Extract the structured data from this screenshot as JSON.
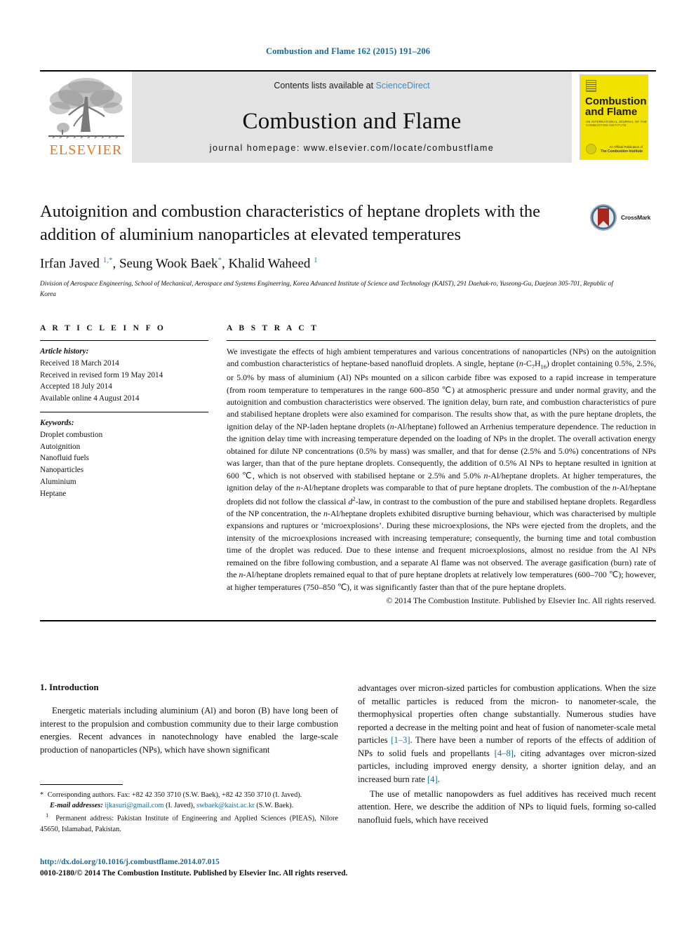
{
  "running_head": "Combustion and Flame 162 (2015) 191–206",
  "masthead": {
    "contents_prefix": "Contents lists available at ",
    "sciencedirect": "ScienceDirect",
    "journal_title": "Combustion and Flame",
    "homepage": "journal homepage: www.elsevier.com/locate/combustflame",
    "publisher_name": "ELSEVIER",
    "cover": {
      "line1": "Combustion",
      "line2": "and Flame",
      "subtitle": "AN INTERNATIONAL JOURNAL OF THE COMBUSTION INSTITUTE",
      "footer_small": "An Official Publication of",
      "footer_bold": "The Combustion Institute"
    }
  },
  "article": {
    "title": "Autoignition and combustion characteristics of heptane droplets with the addition of aluminium nanoparticles at elevated temperatures",
    "crossmark_label": "CrossMark",
    "authors_html": "Irfan Javed <sup class=\"lnk\">1,*</sup>, Seung Wook Baek<sup class=\"lnk\">*</sup>, Khalid Waheed <sup class=\"lnk\">1</sup>",
    "affiliation": "Division of Aerospace Engineering, School of Mechanical, Aerospace and Systems Engineering, Korea Advanced Institute of Science and Technology (KAIST), 291 Daehak-ro, Yuseong-Gu, Daejeon 305-701, Republic of Korea"
  },
  "article_info": {
    "heading": "A R T I C L E    I N F O",
    "history_label": "Article history:",
    "history": [
      "Received 18 March 2014",
      "Received in revised form 19 May 2014",
      "Accepted 18 July 2014",
      "Available online 4 August 2014"
    ],
    "keywords_label": "Keywords:",
    "keywords": [
      "Droplet combustion",
      "Autoignition",
      "Nanofluid fuels",
      "Nanoparticles",
      "Aluminium",
      "Heptane"
    ]
  },
  "abstract": {
    "heading": "A B S T R A C T",
    "body_html": "We investigate the effects of high ambient temperatures and various concentrations of nanoparticles (NPs) on the autoignition and combustion characteristics of heptane-based nanofluid droplets. A single, heptane (<i>n</i>-C<sub>7</sub>H<sub>16</sub>) droplet containing 0.5%, 2.5%, or 5.0% by mass of aluminium (Al) NPs mounted on a silicon carbide fibre was exposed to a rapid increase in temperature (from room temperature to temperatures in the range 600–850 &#8451;) at atmospheric pressure and under normal gravity, and the autoignition and combustion characteristics were observed. The ignition delay, burn rate, and combustion characteristics of pure and stabilised heptane droplets were also examined for comparison. The results show that, as with the pure heptane droplets, the ignition delay of the NP-laden heptane droplets (<i>n</i>-Al/heptane) followed an Arrhenius temperature dependence. The reduction in the ignition delay time with increasing temperature depended on the loading of NPs in the droplet. The overall activation energy obtained for dilute NP concentrations (0.5% by mass) was smaller, and that for dense (2.5% and 5.0%) concentrations of NPs was larger, than that of the pure heptane droplets. Consequently, the addition of 0.5% Al NPs to heptane resulted in ignition at 600 &#8451;, which is not observed with stabilised heptane or 2.5% and 5.0% <i>n</i>-Al/heptane droplets. At higher temperatures, the ignition delay of the <i>n</i>-Al/heptane droplets was comparable to that of pure heptane droplets. The combustion of the <i>n</i>-Al/heptane droplets did not follow the classical <i>d</i><sup class=\"s\">2</sup>-law, in contrast to the combustion of the pure and stabilised heptane droplets. Regardless of the NP concentration, the <i>n</i>-Al/heptane droplets exhibited disruptive burning behaviour, which was characterised by multiple expansions and ruptures or ‘microexplosions’. During these microexplosions, the NPs were ejected from the droplets, and the intensity of the microexplosions increased with increasing temperature; consequently, the burning time and total combustion time of the droplet was reduced. Due to these intense and frequent microexplosions, almost no residue from the Al NPs remained on the fibre following combustion, and a separate Al flame was not observed. The average gasification (burn) rate of the <i>n</i>-Al/heptane droplets remained equal to that of pure heptane droplets at relatively low temperatures (600–700 &#8451;); however, at higher temperatures (750–850 &#8451;), it was significantly faster than that of the pure heptane droplets.",
    "copyright": "© 2014 The Combustion Institute. Published by Elsevier Inc. All rights reserved."
  },
  "introduction": {
    "heading": "1. Introduction",
    "para1": "Energetic materials including aluminium (Al) and boron (B) have long been of interest to the propulsion and combustion community due to their large combustion energies. Recent advances in nanotechnology have enabled the large-scale production of nanoparticles (NPs), which have shown significant",
    "para2_html": "advantages over micron-sized particles for combustion applications. When the size of metallic particles is reduced from the micron- to nanometer-scale, the thermophysical properties often change substantially. Numerous studies have reported a decrease in the melting point and heat of fusion of nanometer-scale metal particles <span class=\"ref\">[1–3]</span>. There have been a number of reports of the effects of addition of NPs to solid fuels and propellants <span class=\"ref\">[4–8]</span>, citing advantages over micron-sized particles, including improved energy density, a shorter ignition delay, and an increased burn rate <span class=\"ref\">[4]</span>.",
    "para3": "The use of metallic nanopowders as fuel additives has received much recent attention. Here, we describe the addition of NPs to liquid fuels, forming so-called nanofluid fuels, which have received"
  },
  "footnotes": {
    "corresponding_html": "<span class=\"sym\">*</span>&nbsp; Corresponding authors. Fax: +82 42 350 3710 (S.W. Baek), +82 42 350 3710 (I. Javed).",
    "emails_html": "<i>E-mail addresses:</i> <span class=\"mail\">ijkasuri@gmail.com</span> (I. Javed), <span class=\"mail\">swbaek@kaist.ac.kr</span> (S.W. Baek).",
    "permanent_html": "<sup>1</sup>&nbsp; Permanent address: Pakistan Institute of Engineering and Applied Sciences (PIEAS), Nilore 45650, Islamabad, Pakistan."
  },
  "footer": {
    "doi": "http://dx.doi.org/10.1016/j.combustflame.2014.07.015",
    "issn_line": "0010-2180/© 2014 The Combustion Institute. Published by Elsevier Inc. All rights reserved."
  },
  "colors": {
    "link_blue": "#1a6b94",
    "sciencedirect_blue": "#3a8fc4",
    "elsevier_orange": "#e87722",
    "cover_yellow": "#f2e200",
    "band_grey": "#e3e3e3"
  }
}
